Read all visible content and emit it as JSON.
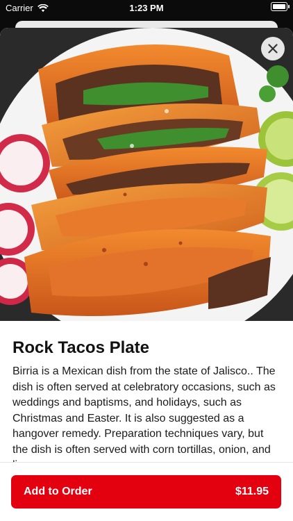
{
  "status_bar": {
    "carrier": "Carrier",
    "time": "1:23 PM"
  },
  "item": {
    "title": "Rock Tacos Plate",
    "description": "Birria is a Mexican dish from the state of Jalisco.. The dish is often served at celebratory occasions, such as weddings and baptisms, and holidays, such as Christmas and Easter. It is also suggested as a hangover remedy. Preparation techniques vary, but the dish is often served with corn tortillas, onion, and lime, a..."
  },
  "order_button": {
    "label": "Add to Order",
    "price": "$11.95"
  },
  "colors": {
    "accent": "#e3000f"
  }
}
